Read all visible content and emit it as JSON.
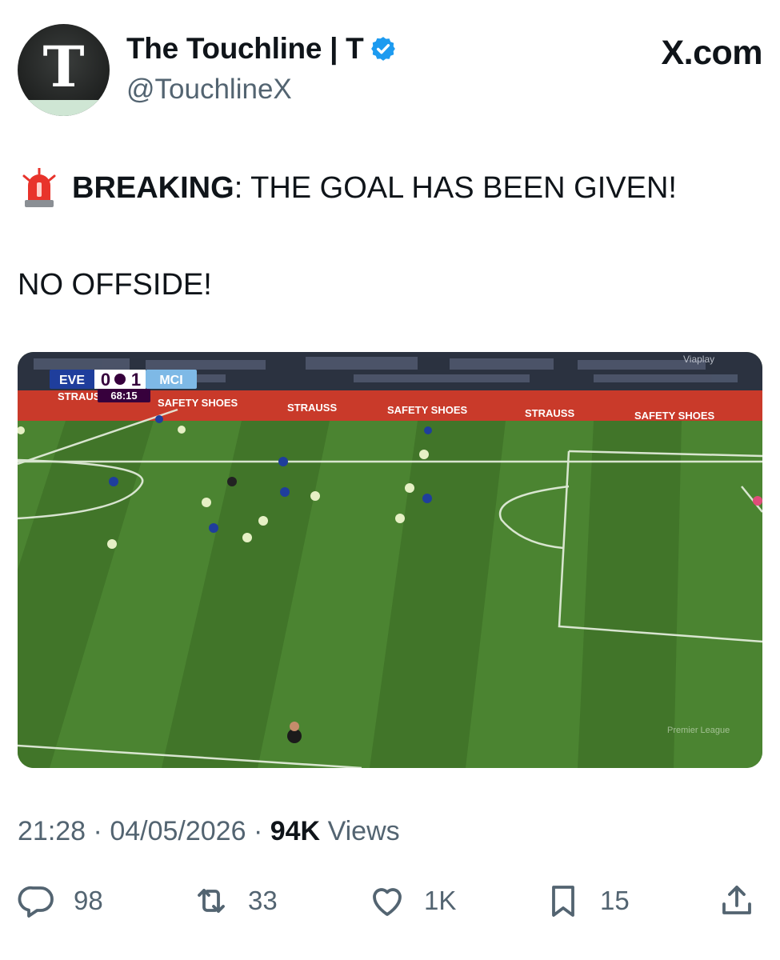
{
  "author": {
    "display_name": "The Touchline | T",
    "handle": "@TouchlineX",
    "avatar_letter": "T"
  },
  "brand": "X.com",
  "tweet": {
    "breaking_label": "BREAKING",
    "line1_rest": ": THE GOAL HAS BEEN GIVEN!",
    "line2": "NO OFFSIDE!"
  },
  "media": {
    "scoreboard": {
      "home": "EVE",
      "home_score": "0",
      "away_score": "1",
      "away": "MCI",
      "clock": "68:15"
    },
    "ad_boards": [
      "STRAUSS",
      "SAFETY SHOES",
      "STRAUSS",
      "SAFETY SHOES",
      "STRAUSS",
      "SAFETY SHOES"
    ],
    "broadcaster": "Viaplay",
    "watermark": "Premier League"
  },
  "meta": {
    "time": "21:28",
    "date": "04/05/2026",
    "views_count": "94K",
    "views_label": "Views"
  },
  "actions": {
    "replies": "98",
    "reposts": "33",
    "likes": "1K",
    "bookmarks": "15"
  },
  "colors": {
    "text": "#0f1419",
    "muted": "#536471",
    "verified": "#1d9bf0",
    "pitch_light": "#4f8a35",
    "pitch_dark": "#3c6c27"
  }
}
